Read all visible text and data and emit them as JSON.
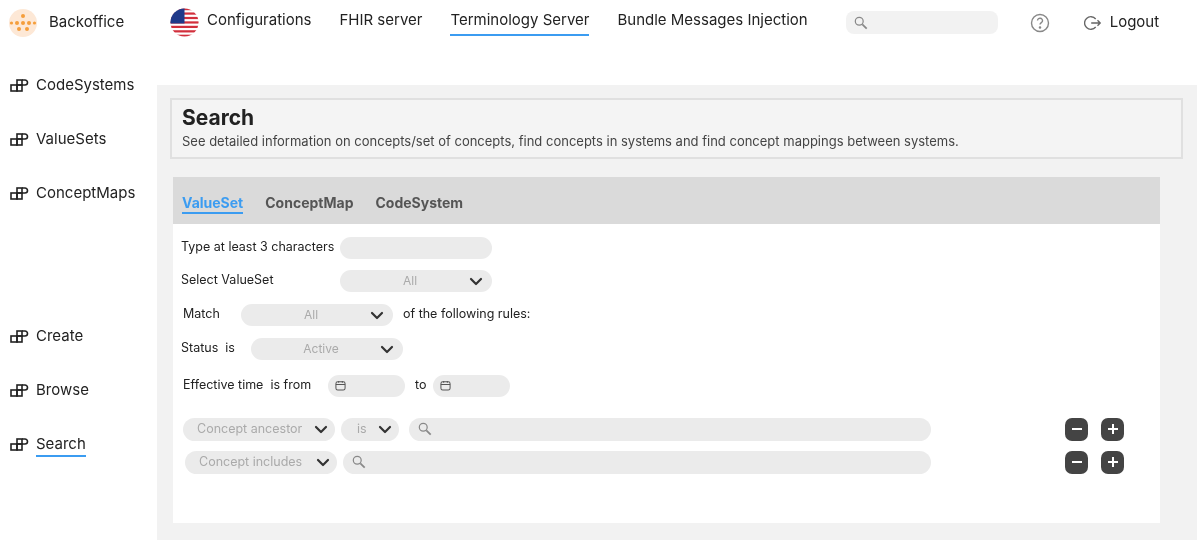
{
  "brand": {
    "name": "Backoffice"
  },
  "nav": [
    {
      "label": "Configurations",
      "selected": false,
      "kind": "flag"
    },
    {
      "label": "FHIR server",
      "selected": false,
      "kind": "plain"
    },
    {
      "label": "Terminology Server",
      "selected": true,
      "kind": "plain"
    },
    {
      "label": "Bundle Messages Injection",
      "selected": false,
      "kind": "plain"
    }
  ],
  "logout": "Logout",
  "sidebar": {
    "groups": [
      {
        "items": [
          {
            "label": "CodeSystems",
            "selected": false
          },
          {
            "label": "ValueSets",
            "selected": false
          },
          {
            "label": "ConceptMaps",
            "selected": false
          }
        ]
      },
      {
        "items": [
          {
            "label": "Create",
            "selected": false
          },
          {
            "label": "Browse",
            "selected": false
          },
          {
            "label": "Search",
            "selected": true
          }
        ]
      }
    ]
  },
  "header": {
    "title": "Search",
    "description": "See detailed information on concepts/set of concepts, find concepts in systems and find concept mappings between systems."
  },
  "tabs": [
    {
      "label": "ValueSet",
      "selected": true
    },
    {
      "label": "ConceptMap",
      "selected": false
    },
    {
      "label": "CodeSystem",
      "selected": false
    }
  ],
  "form": {
    "text_filter": {
      "label": "Type at least 3 characters"
    },
    "valueset": {
      "label": "Select ValueSet",
      "value": "All"
    },
    "match": {
      "label": "Match",
      "value": "All",
      "suffix": "of the following rules:"
    },
    "status": {
      "label": "Status  is",
      "value": "Active"
    },
    "effective": {
      "label": "Effective time  is from",
      "to": "to"
    }
  },
  "rules": [
    {
      "field": "Concept ancestor",
      "operator": "is"
    },
    {
      "field": "Concept includes"
    }
  ]
}
